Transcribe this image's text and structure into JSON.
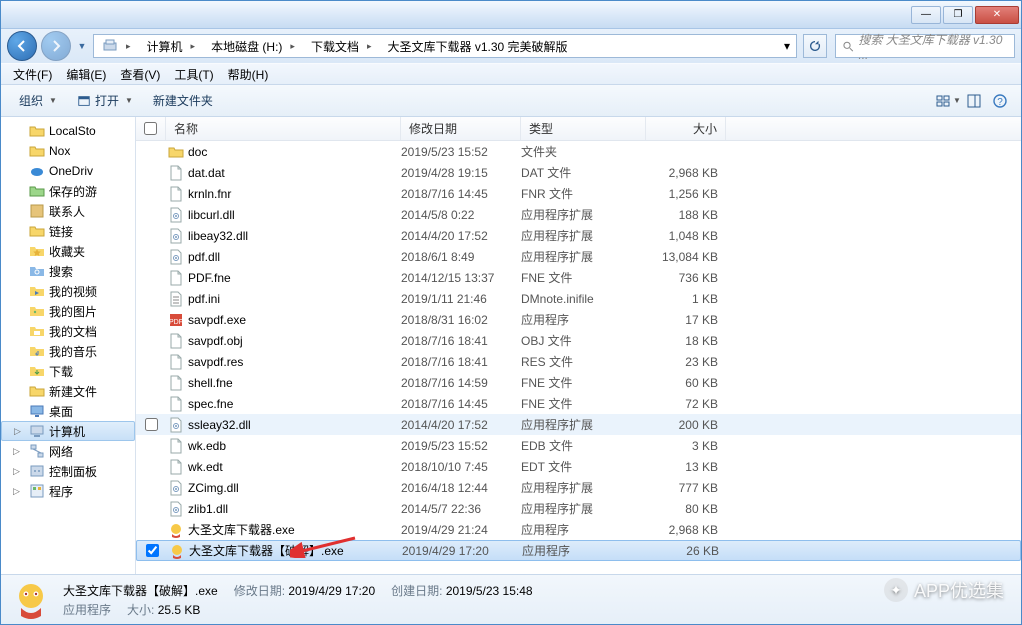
{
  "title_controls": {
    "min": "—",
    "max": "❐",
    "close": "✕"
  },
  "breadcrumb": [
    {
      "label": "计算机"
    },
    {
      "label": "本地磁盘 (H:)"
    },
    {
      "label": "下载文档"
    },
    {
      "label": "大圣文库下载器 v1.30 完美破解版"
    }
  ],
  "search_placeholder": "搜索 大圣文库下载器 v1.30 ...",
  "menu": [
    {
      "label": "文件(F)"
    },
    {
      "label": "编辑(E)"
    },
    {
      "label": "查看(V)"
    },
    {
      "label": "工具(T)"
    },
    {
      "label": "帮助(H)"
    }
  ],
  "toolbar": {
    "organize": "组织",
    "open": "打开",
    "new_folder": "新建文件夹"
  },
  "sidebar": {
    "items": [
      {
        "label": "LocalSto",
        "icon": "folder"
      },
      {
        "label": "Nox",
        "icon": "folder"
      },
      {
        "label": "OneDriv",
        "icon": "onedrive"
      },
      {
        "label": "保存的游",
        "icon": "folder-green"
      },
      {
        "label": "联系人",
        "icon": "contacts"
      },
      {
        "label": "链接",
        "icon": "folder"
      },
      {
        "label": "收藏夹",
        "icon": "favorites"
      },
      {
        "label": "搜索",
        "icon": "search-folder"
      },
      {
        "label": "我的视频",
        "icon": "video"
      },
      {
        "label": "我的图片",
        "icon": "pictures"
      },
      {
        "label": "我的文档",
        "icon": "documents"
      },
      {
        "label": "我的音乐",
        "icon": "music"
      },
      {
        "label": "下载",
        "icon": "downloads"
      },
      {
        "label": "新建文件",
        "icon": "folder"
      },
      {
        "label": "桌面",
        "icon": "desktop"
      },
      {
        "label": "计算机",
        "icon": "computer",
        "selected": true,
        "expandable": true
      },
      {
        "label": "网络",
        "icon": "network",
        "expandable": true
      },
      {
        "label": "控制面板",
        "icon": "control-panel",
        "expandable": true
      },
      {
        "label": "程序",
        "icon": "programs",
        "expandable": true
      }
    ]
  },
  "columns": {
    "name": "名称",
    "date": "修改日期",
    "type": "类型",
    "size": "大小"
  },
  "files": [
    {
      "name": "doc",
      "date": "2019/5/23 15:52",
      "type": "文件夹",
      "size": "",
      "icon": "folder"
    },
    {
      "name": "dat.dat",
      "date": "2019/4/28 19:15",
      "type": "DAT 文件",
      "size": "2,968 KB",
      "icon": "file"
    },
    {
      "name": "krnln.fnr",
      "date": "2018/7/16 14:45",
      "type": "FNR 文件",
      "size": "1,256 KB",
      "icon": "file"
    },
    {
      "name": "libcurl.dll",
      "date": "2014/5/8 0:22",
      "type": "应用程序扩展",
      "size": "188 KB",
      "icon": "dll"
    },
    {
      "name": "libeay32.dll",
      "date": "2014/4/20 17:52",
      "type": "应用程序扩展",
      "size": "1,048 KB",
      "icon": "dll"
    },
    {
      "name": "pdf.dll",
      "date": "2018/6/1 8:49",
      "type": "应用程序扩展",
      "size": "13,084 KB",
      "icon": "dll"
    },
    {
      "name": "PDF.fne",
      "date": "2014/12/15 13:37",
      "type": "FNE 文件",
      "size": "736 KB",
      "icon": "file"
    },
    {
      "name": "pdf.ini",
      "date": "2019/1/11 21:46",
      "type": "DMnote.inifile",
      "size": "1 KB",
      "icon": "ini"
    },
    {
      "name": "savpdf.exe",
      "date": "2018/8/31 16:02",
      "type": "应用程序",
      "size": "17 KB",
      "icon": "exe-red"
    },
    {
      "name": "savpdf.obj",
      "date": "2018/7/16 18:41",
      "type": "OBJ 文件",
      "size": "18 KB",
      "icon": "file"
    },
    {
      "name": "savpdf.res",
      "date": "2018/7/16 18:41",
      "type": "RES 文件",
      "size": "23 KB",
      "icon": "file"
    },
    {
      "name": "shell.fne",
      "date": "2018/7/16 14:59",
      "type": "FNE 文件",
      "size": "60 KB",
      "icon": "file"
    },
    {
      "name": "spec.fne",
      "date": "2018/7/16 14:45",
      "type": "FNE 文件",
      "size": "72 KB",
      "icon": "file"
    },
    {
      "name": "ssleay32.dll",
      "date": "2014/4/20 17:52",
      "type": "应用程序扩展",
      "size": "200 KB",
      "icon": "dll",
      "hover": true
    },
    {
      "name": "wk.edb",
      "date": "2019/5/23 15:52",
      "type": "EDB 文件",
      "size": "3 KB",
      "icon": "file"
    },
    {
      "name": "wk.edt",
      "date": "2018/10/10 7:45",
      "type": "EDT 文件",
      "size": "13 KB",
      "icon": "file"
    },
    {
      "name": "ZCimg.dll",
      "date": "2016/4/18 12:44",
      "type": "应用程序扩展",
      "size": "777 KB",
      "icon": "dll"
    },
    {
      "name": "zlib1.dll",
      "date": "2014/5/7 22:36",
      "type": "应用程序扩展",
      "size": "80 KB",
      "icon": "dll"
    },
    {
      "name": "大圣文库下载器.exe",
      "date": "2019/4/29 21:24",
      "type": "应用程序",
      "size": "2,968 KB",
      "icon": "exe-app"
    },
    {
      "name": "大圣文库下载器【破解】.exe",
      "date": "2019/4/29 17:20",
      "type": "应用程序",
      "size": "26 KB",
      "icon": "exe-app",
      "selected": true,
      "checked": true
    }
  ],
  "details": {
    "filename": "大圣文库下载器【破解】.exe",
    "mod_label": "修改日期:",
    "mod_value": "2019/4/29 17:20",
    "create_label": "创建日期:",
    "create_value": "2019/5/23 15:48",
    "type_label": "应用程序",
    "size_label": "大小:",
    "size_value": "25.5 KB"
  },
  "watermark": "APP优选集"
}
